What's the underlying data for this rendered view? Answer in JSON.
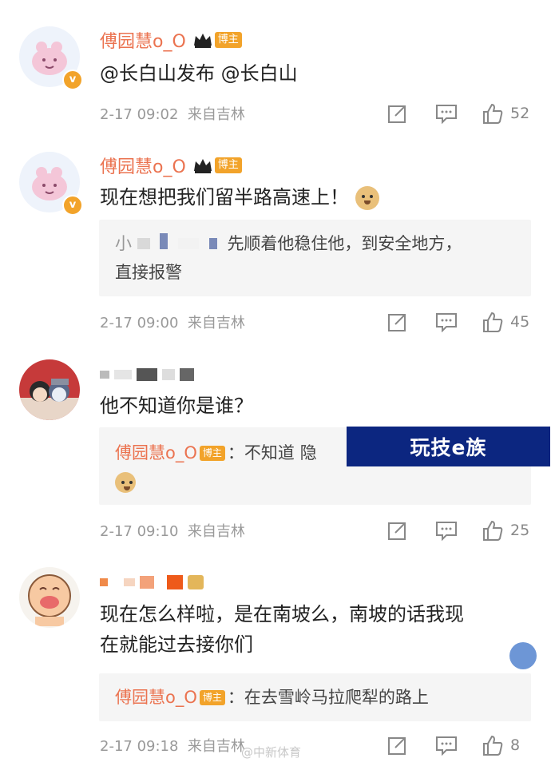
{
  "comments": [
    {
      "username": "傅园慧o_O",
      "badge": "博主",
      "text": "@长白山发布 @长白山",
      "time": "2-17 09:02",
      "location": "来自吉林",
      "likes": "52"
    },
    {
      "username": "傅园慧o_O",
      "badge": "博主",
      "text": "现在想把我们留半路高速上！",
      "reply": {
        "prefix": "小",
        "text": "先顺着他稳住他，到安全地方，",
        "text2": "直接报警"
      },
      "time": "2-17 09:00",
      "location": "来自吉林",
      "likes": "45"
    },
    {
      "text": "他不知道你是谁？",
      "reply": {
        "name": "傅园慧o_O",
        "badge": "博主",
        "text": "：不知道 隐"
      },
      "time": "2-17 09:10",
      "location": "来自吉林",
      "likes": "25"
    },
    {
      "text_line1": "现在怎么样啦，是在南坡么，南坡的话我现",
      "text_line2": "在就能过去接你们",
      "reply": {
        "name": "傅园慧o_O",
        "badge": "博主",
        "text": "：在去雪岭马拉爬犁的路上"
      },
      "time": "2-17 09:18",
      "location": "来自吉林",
      "likes": "8"
    }
  ],
  "banner": "玩技e族",
  "watermark": "@中新体育",
  "colors": {
    "username": "#eb7350",
    "badge": "#f2a32a",
    "reply_bg": "#f5f5f5",
    "meta": "#999999",
    "banner_bg": "#0c2680"
  },
  "icons": [
    "repost-icon",
    "comment-icon",
    "like-icon",
    "crown-icon",
    "verified-icon",
    "doge-emoji"
  ]
}
